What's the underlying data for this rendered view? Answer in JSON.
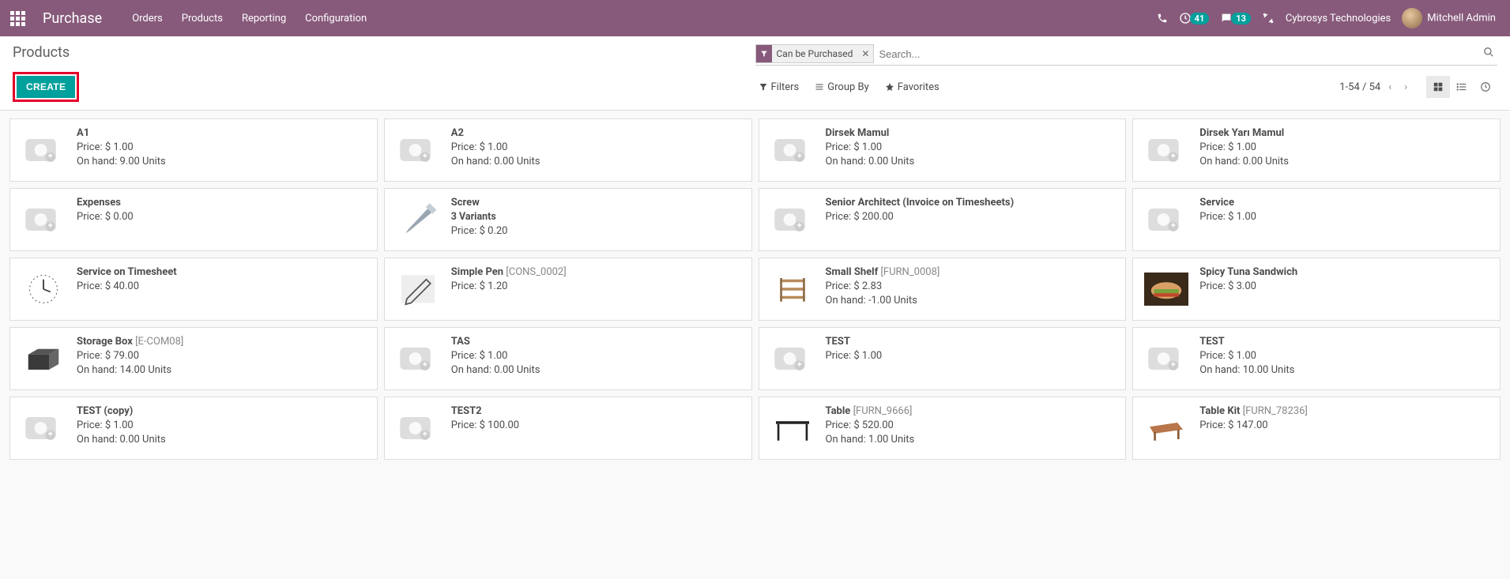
{
  "nav": {
    "app": "Purchase",
    "links": [
      "Orders",
      "Products",
      "Reporting",
      "Configuration"
    ],
    "activity_badge": "41",
    "msg_badge": "13",
    "company": "Cybrosys Technologies",
    "user": "Mitchell Admin"
  },
  "control": {
    "breadcrumb": "Products",
    "facet_label": "Can be Purchased",
    "search_placeholder": "Search...",
    "create": "CREATE",
    "filters_label": "Filters",
    "groupby_label": "Group By",
    "favorites_label": "Favorites",
    "pager": "1-54 / 54"
  },
  "products": [
    {
      "name": "A1",
      "code": "",
      "price": "Price: $ 1.00",
      "onhand": "On hand: 9.00 Units",
      "thumb": "placeholder"
    },
    {
      "name": "A2",
      "code": "",
      "price": "Price: $ 1.00",
      "onhand": "On hand: 0.00 Units",
      "thumb": "placeholder"
    },
    {
      "name": "Dirsek Mamul",
      "code": "",
      "price": "Price: $ 1.00",
      "onhand": "On hand: 0.00 Units",
      "thumb": "placeholder"
    },
    {
      "name": "Dirsek Yarı Mamul",
      "code": "",
      "price": "Price: $ 1.00",
      "onhand": "On hand: 0.00 Units",
      "thumb": "placeholder"
    },
    {
      "name": "Expenses",
      "code": "",
      "price": "Price: $ 0.00",
      "onhand": "",
      "thumb": "placeholder"
    },
    {
      "name": "Screw",
      "code": "",
      "sub": "3 Variants",
      "price": "Price: $ 0.20",
      "onhand": "",
      "thumb": "screw"
    },
    {
      "name": "Senior Architect (Invoice on Timesheets)",
      "code": "",
      "price": "Price: $ 200.00",
      "onhand": "",
      "thumb": "placeholder"
    },
    {
      "name": "Service",
      "code": "",
      "price": "Price: $ 1.00",
      "onhand": "",
      "thumb": "placeholder"
    },
    {
      "name": "Service on Timesheet",
      "code": "",
      "price": "Price: $ 40.00",
      "onhand": "",
      "thumb": "clock"
    },
    {
      "name": "Simple Pen",
      "code": "[CONS_0002]",
      "price": "Price: $ 1.20",
      "onhand": "",
      "thumb": "pen"
    },
    {
      "name": "Small Shelf",
      "code": "[FURN_0008]",
      "price": "Price: $ 2.83",
      "onhand": "On hand: -1.00 Units",
      "thumb": "shelf"
    },
    {
      "name": "Spicy Tuna Sandwich",
      "code": "",
      "price": "Price: $ 3.00",
      "onhand": "",
      "thumb": "sandwich"
    },
    {
      "name": "Storage Box",
      "code": "[E-COM08]",
      "price": "Price: $ 79.00",
      "onhand": "On hand: 14.00 Units",
      "thumb": "box"
    },
    {
      "name": "TAS",
      "code": "",
      "price": "Price: $ 1.00",
      "onhand": "On hand: 0.00 Units",
      "thumb": "placeholder"
    },
    {
      "name": "TEST",
      "code": "",
      "price": "Price: $ 1.00",
      "onhand": "",
      "thumb": "placeholder"
    },
    {
      "name": "TEST",
      "code": "",
      "price": "Price: $ 1.00",
      "onhand": "On hand: 10.00 Units",
      "thumb": "placeholder"
    },
    {
      "name": "TEST (copy)",
      "code": "",
      "price": "Price: $ 1.00",
      "onhand": "On hand: 0.00 Units",
      "thumb": "placeholder"
    },
    {
      "name": "TEST2",
      "code": "",
      "price": "Price: $ 100.00",
      "onhand": "",
      "thumb": "placeholder"
    },
    {
      "name": "Table",
      "code": "[FURN_9666]",
      "price": "Price: $ 520.00",
      "onhand": "On hand: 1.00 Units",
      "thumb": "table"
    },
    {
      "name": "Table Kit",
      "code": "[FURN_78236]",
      "price": "Price: $ 147.00",
      "onhand": "",
      "thumb": "tablekit"
    }
  ]
}
